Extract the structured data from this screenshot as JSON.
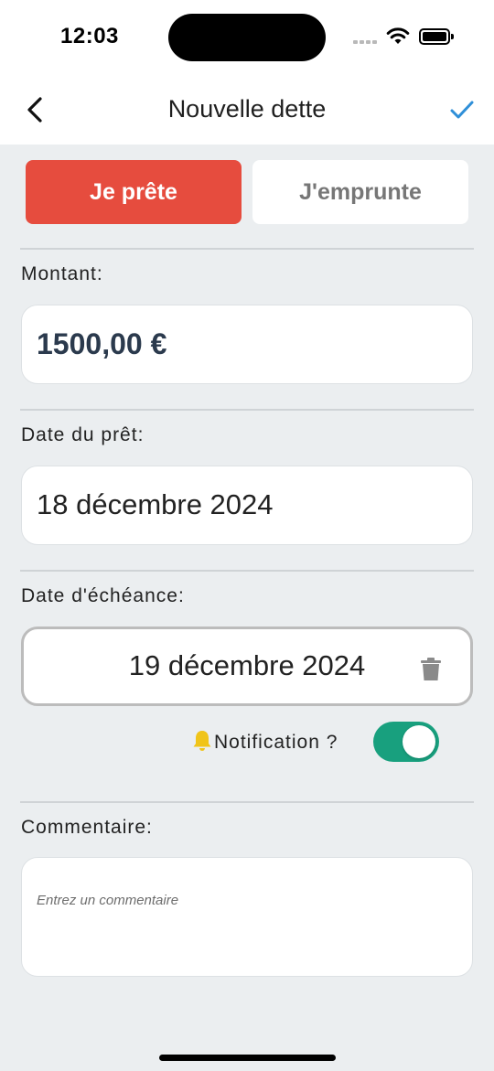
{
  "status_bar": {
    "time": "12:03"
  },
  "nav": {
    "title": "Nouvelle dette",
    "back_icon": "chevron-left-icon",
    "confirm_icon": "checkmark-icon",
    "accent_color": "#2f8fd8"
  },
  "segments": {
    "lend_label": "Je prête",
    "borrow_label": "J'emprunte",
    "selected": "lend",
    "selected_color": "#e64c3e"
  },
  "amount": {
    "label": "Montant:",
    "value": "1500,00 €"
  },
  "loan_date": {
    "label": "Date du prêt:",
    "value": "18 décembre 2024"
  },
  "due_date": {
    "label": "Date d'échéance:",
    "value": "19 décembre 2024",
    "delete_icon": "trash-icon"
  },
  "notification": {
    "icon": "bell-icon",
    "label": "Notification ?",
    "enabled": true,
    "toggle_color": "#18a07e"
  },
  "comment": {
    "label": "Commentaire:",
    "placeholder": "Entrez un commentaire",
    "value": ""
  }
}
